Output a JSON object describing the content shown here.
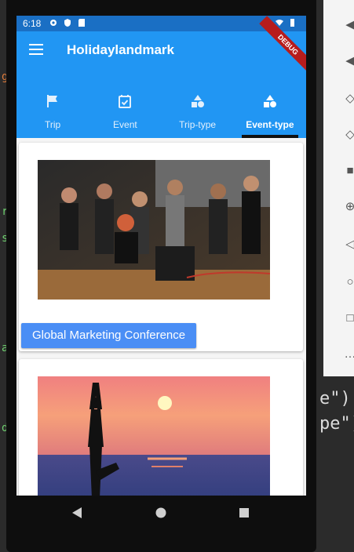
{
  "ide": {
    "left_chars": [
      "g",
      "r",
      "s",
      "a",
      "d"
    ],
    "right_code": [
      "e\"),",
      "pe\")"
    ]
  },
  "statusbar": {
    "time": "6:18"
  },
  "appbar": {
    "title": "Holidaylandmark",
    "debug_label": "DEBUG"
  },
  "tabs": [
    {
      "label": "Trip",
      "icon": "flag-icon",
      "active": false
    },
    {
      "label": "Event",
      "icon": "calendar-check-icon",
      "active": false
    },
    {
      "label": "Trip-type",
      "icon": "category-icon",
      "active": false
    },
    {
      "label": "Event-type",
      "icon": "category-icon",
      "active": true
    }
  ],
  "cards": [
    {
      "button_label": "Global Marketing Conference",
      "image": "conference-crowd-photo"
    },
    {
      "image": "yoga-sunset-photo"
    }
  ],
  "colors": {
    "appbar": "#2196f3",
    "statusbar": "#1a6fc4",
    "button": "#4a8ef5",
    "tab_indicator": "#111111"
  }
}
